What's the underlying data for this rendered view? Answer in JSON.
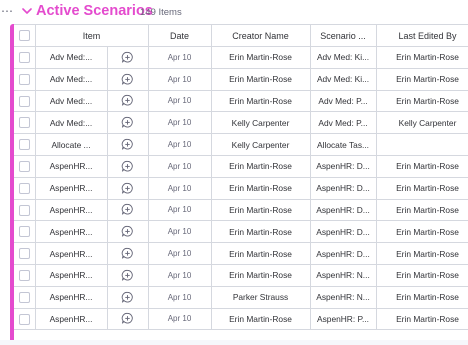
{
  "group": {
    "title": "Active Scenarios",
    "count": "149 Items",
    "color": "#e44bce"
  },
  "columns": {
    "item": "Item",
    "date": "Date",
    "creator": "Creator Name",
    "scenario": "Scenario ...",
    "last_edited": "Last Edited By"
  },
  "rows": [
    {
      "item": "Adv Med:...",
      "date": "Apr 10",
      "creator": "Erin Martin-Rose",
      "scenario": "Adv Med: Ki...",
      "last_edited": "Erin Martin-Rose"
    },
    {
      "item": "Adv Med:...",
      "date": "Apr 10",
      "creator": "Erin Martin-Rose",
      "scenario": "Adv Med: Ki...",
      "last_edited": "Erin Martin-Rose"
    },
    {
      "item": "Adv Med:...",
      "date": "Apr 10",
      "creator": "Erin Martin-Rose",
      "scenario": "Adv Med: P...",
      "last_edited": "Erin Martin-Rose"
    },
    {
      "item": "Adv Med:...",
      "date": "Apr 10",
      "creator": "Kelly Carpenter",
      "scenario": "Adv Med: P...",
      "last_edited": "Kelly Carpenter"
    },
    {
      "item": "Allocate ...",
      "date": "Apr 10",
      "creator": "Kelly Carpenter",
      "scenario": "Allocate Tas...",
      "last_edited": ""
    },
    {
      "item": "AspenHR...",
      "date": "Apr 10",
      "creator": "Erin Martin-Rose",
      "scenario": "AspenHR: D...",
      "last_edited": "Erin Martin-Rose"
    },
    {
      "item": "AspenHR...",
      "date": "Apr 10",
      "creator": "Erin Martin-Rose",
      "scenario": "AspenHR: D...",
      "last_edited": "Erin Martin-Rose"
    },
    {
      "item": "AspenHR...",
      "date": "Apr 10",
      "creator": "Erin Martin-Rose",
      "scenario": "AspenHR: D...",
      "last_edited": "Erin Martin-Rose"
    },
    {
      "item": "AspenHR...",
      "date": "Apr 10",
      "creator": "Erin Martin-Rose",
      "scenario": "AspenHR: D...",
      "last_edited": "Erin Martin-Rose"
    },
    {
      "item": "AspenHR...",
      "date": "Apr 10",
      "creator": "Erin Martin-Rose",
      "scenario": "AspenHR: D...",
      "last_edited": "Erin Martin-Rose"
    },
    {
      "item": "AspenHR...",
      "date": "Apr 10",
      "creator": "Erin Martin-Rose",
      "scenario": "AspenHR: N...",
      "last_edited": "Erin Martin-Rose"
    },
    {
      "item": "AspenHR...",
      "date": "Apr 10",
      "creator": "Parker Strauss",
      "scenario": "AspenHR: N...",
      "last_edited": "Erin Martin-Rose"
    },
    {
      "item": "AspenHR...",
      "date": "Apr 10",
      "creator": "Erin Martin-Rose",
      "scenario": "AspenHR: P...",
      "last_edited": "Erin Martin-Rose"
    }
  ],
  "icons": {
    "row_update": "add-update-icon",
    "collapse": "chevron-down-icon",
    "menu": "more-dots-icon"
  }
}
